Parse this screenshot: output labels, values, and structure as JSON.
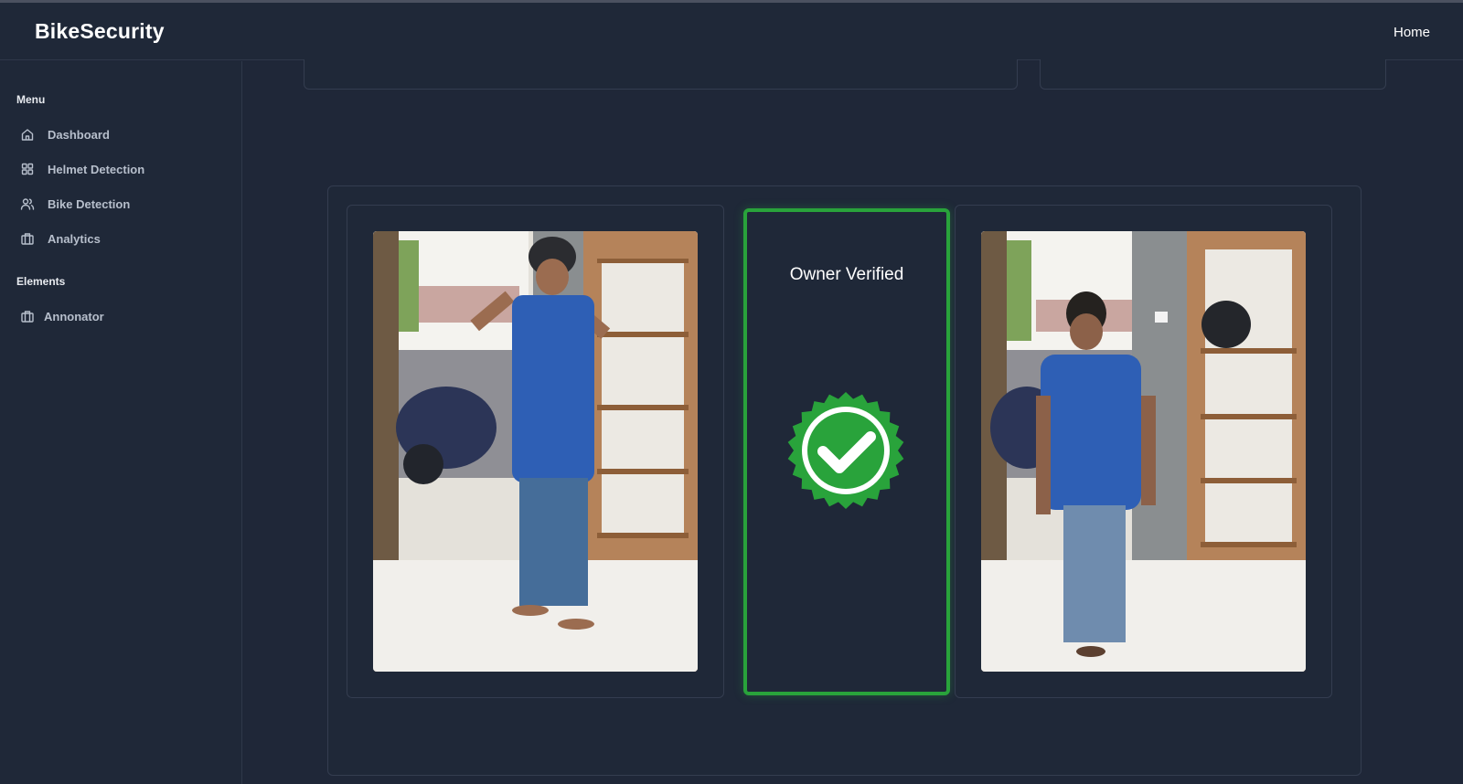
{
  "header": {
    "brand": "BikeSecurity",
    "home_link": "Home"
  },
  "sidebar": {
    "menu_title": "Menu",
    "menu_items": [
      {
        "label": "Dashboard",
        "icon": "home-icon"
      },
      {
        "label": "Helmet Detection",
        "icon": "grid-icon"
      },
      {
        "label": "Bike Detection",
        "icon": "users-icon"
      },
      {
        "label": "Analytics",
        "icon": "briefcase-icon"
      }
    ],
    "elements_title": "Elements",
    "element_items": [
      {
        "label": "Annonator",
        "icon": "briefcase-icon"
      }
    ]
  },
  "verification": {
    "status_text": "Owner Verified",
    "status_color": "#29a33b",
    "badge_icon": "verified-check-badge-icon"
  },
  "images": {
    "left": {
      "icon": "photo-person-wearing-helmet"
    },
    "right": {
      "icon": "photo-person-without-helmet"
    }
  }
}
